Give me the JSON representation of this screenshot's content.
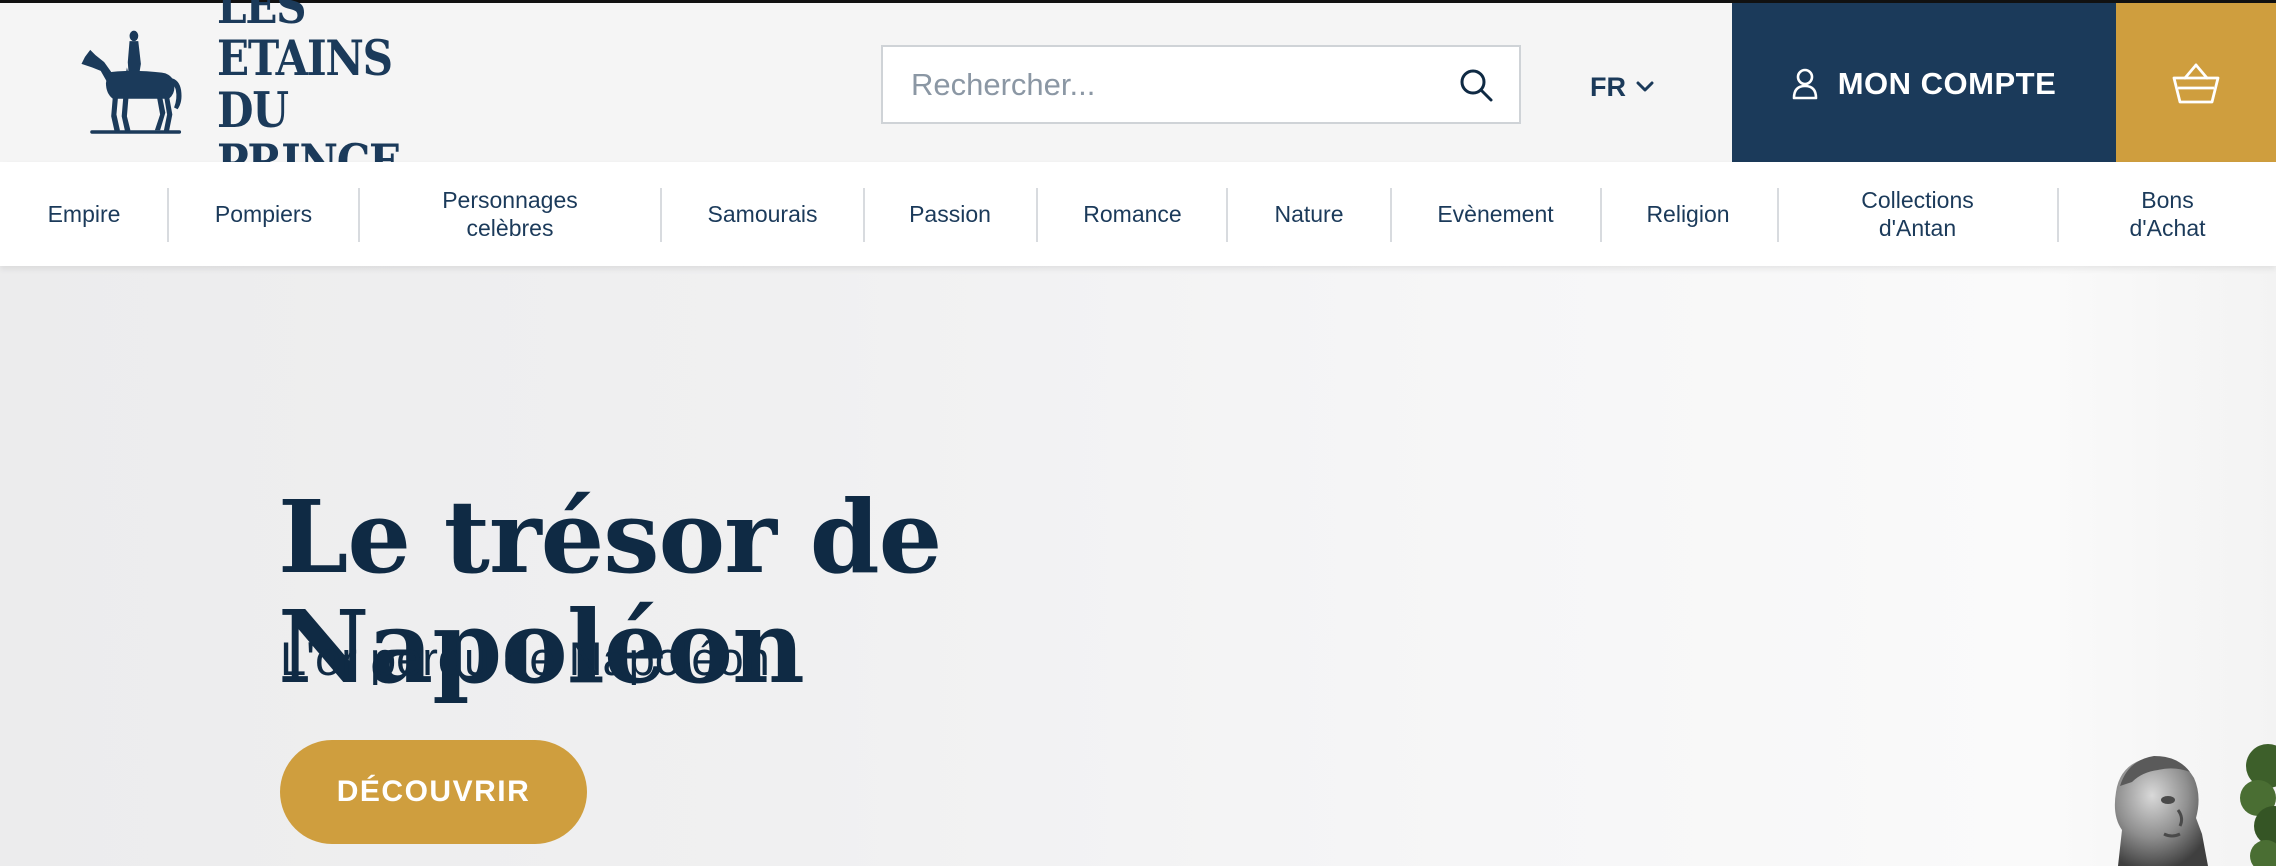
{
  "brand": {
    "name_line1": "LES ETAINS",
    "name_line2": "DU PRINCE"
  },
  "search": {
    "placeholder": "Rechercher..."
  },
  "language": {
    "current": "FR"
  },
  "account": {
    "label": "MON COMPTE"
  },
  "nav": {
    "items": [
      {
        "label": "Empire"
      },
      {
        "label": "Pompiers"
      },
      {
        "label": "Personnages\ncelèbres"
      },
      {
        "label": "Samourais"
      },
      {
        "label": "Passion"
      },
      {
        "label": "Romance"
      },
      {
        "label": "Nature"
      },
      {
        "label": "Evènement"
      },
      {
        "label": "Religion"
      },
      {
        "label": "Collections\nd'Antan"
      },
      {
        "label": "Bons\nd'Achat"
      }
    ]
  },
  "hero": {
    "title": "Le trésor de Napoléon",
    "subtitle": "L'or perdu de Napoléon",
    "cta_label": "DÉCOUVRIR"
  },
  "colors": {
    "navy": "#1b3a5a",
    "gold": "#cf9e3e",
    "header_bg": "#f5f5f5"
  },
  "icons": {
    "brand": "horse-rider-logo-icon",
    "search": "search-icon",
    "language": "chevron-down-icon",
    "account": "user-icon",
    "cart": "basket-icon"
  }
}
